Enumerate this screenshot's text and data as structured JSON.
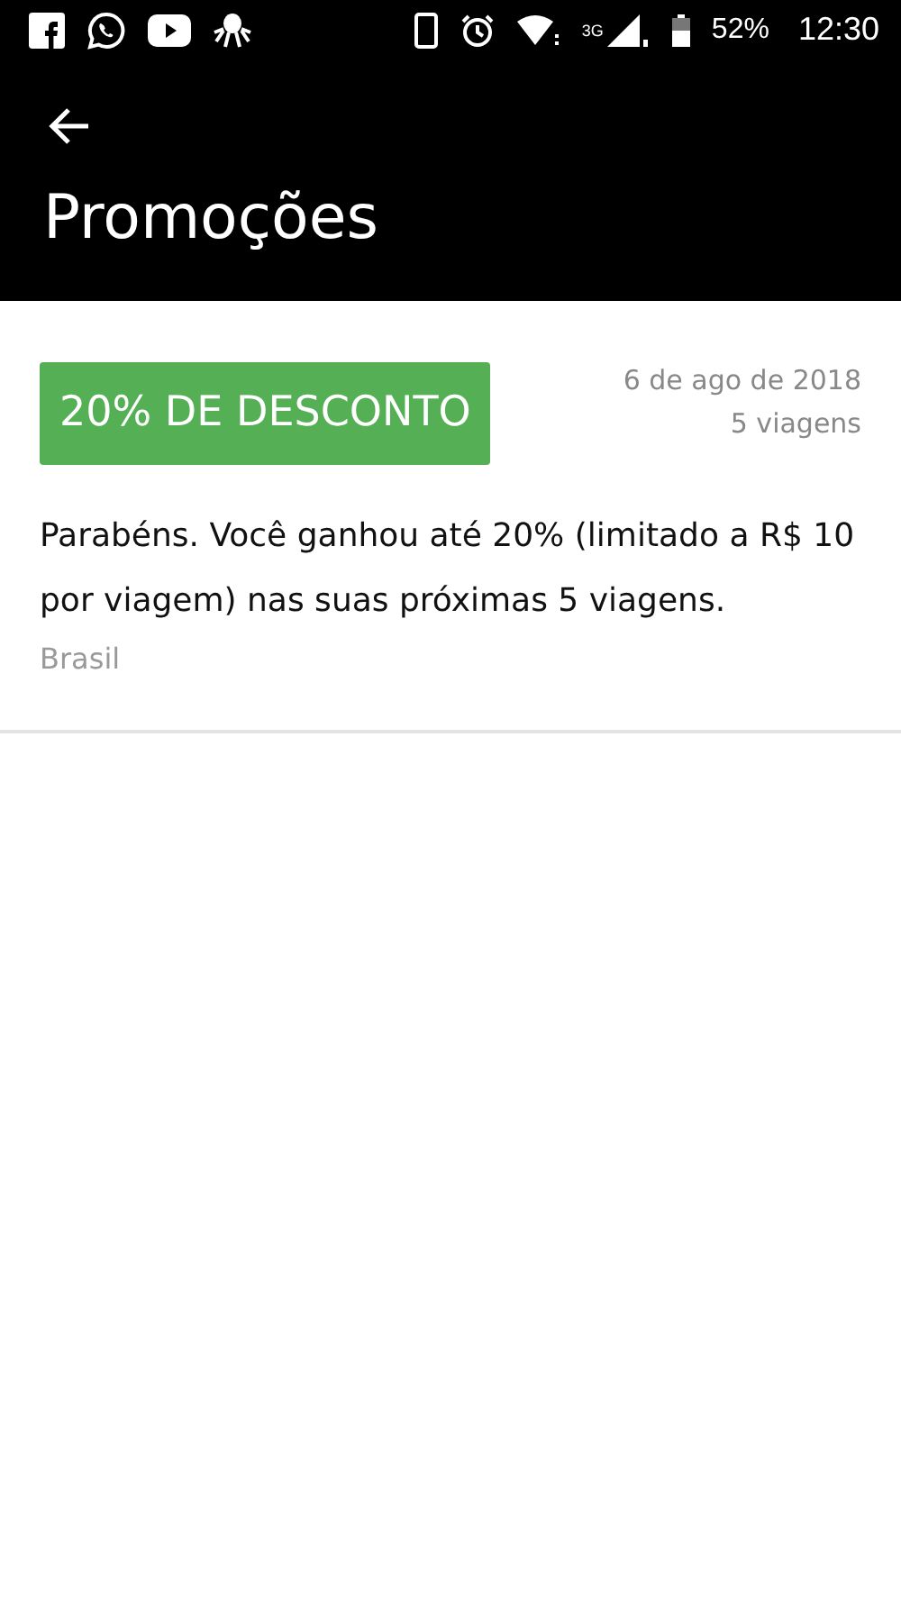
{
  "status_bar": {
    "network": "3G",
    "battery": "52%",
    "time": "12:30"
  },
  "header": {
    "title": "Promoções"
  },
  "promotions": [
    {
      "badge": "20% DE DESCONTO",
      "date": "6 de ago de 2018",
      "trips": "5 viagens",
      "description": "Parabéns. Você ganhou até 20% (limitado a R$ 10 por viagem) nas suas próximas 5 viagens.",
      "region": "Brasil"
    }
  ]
}
